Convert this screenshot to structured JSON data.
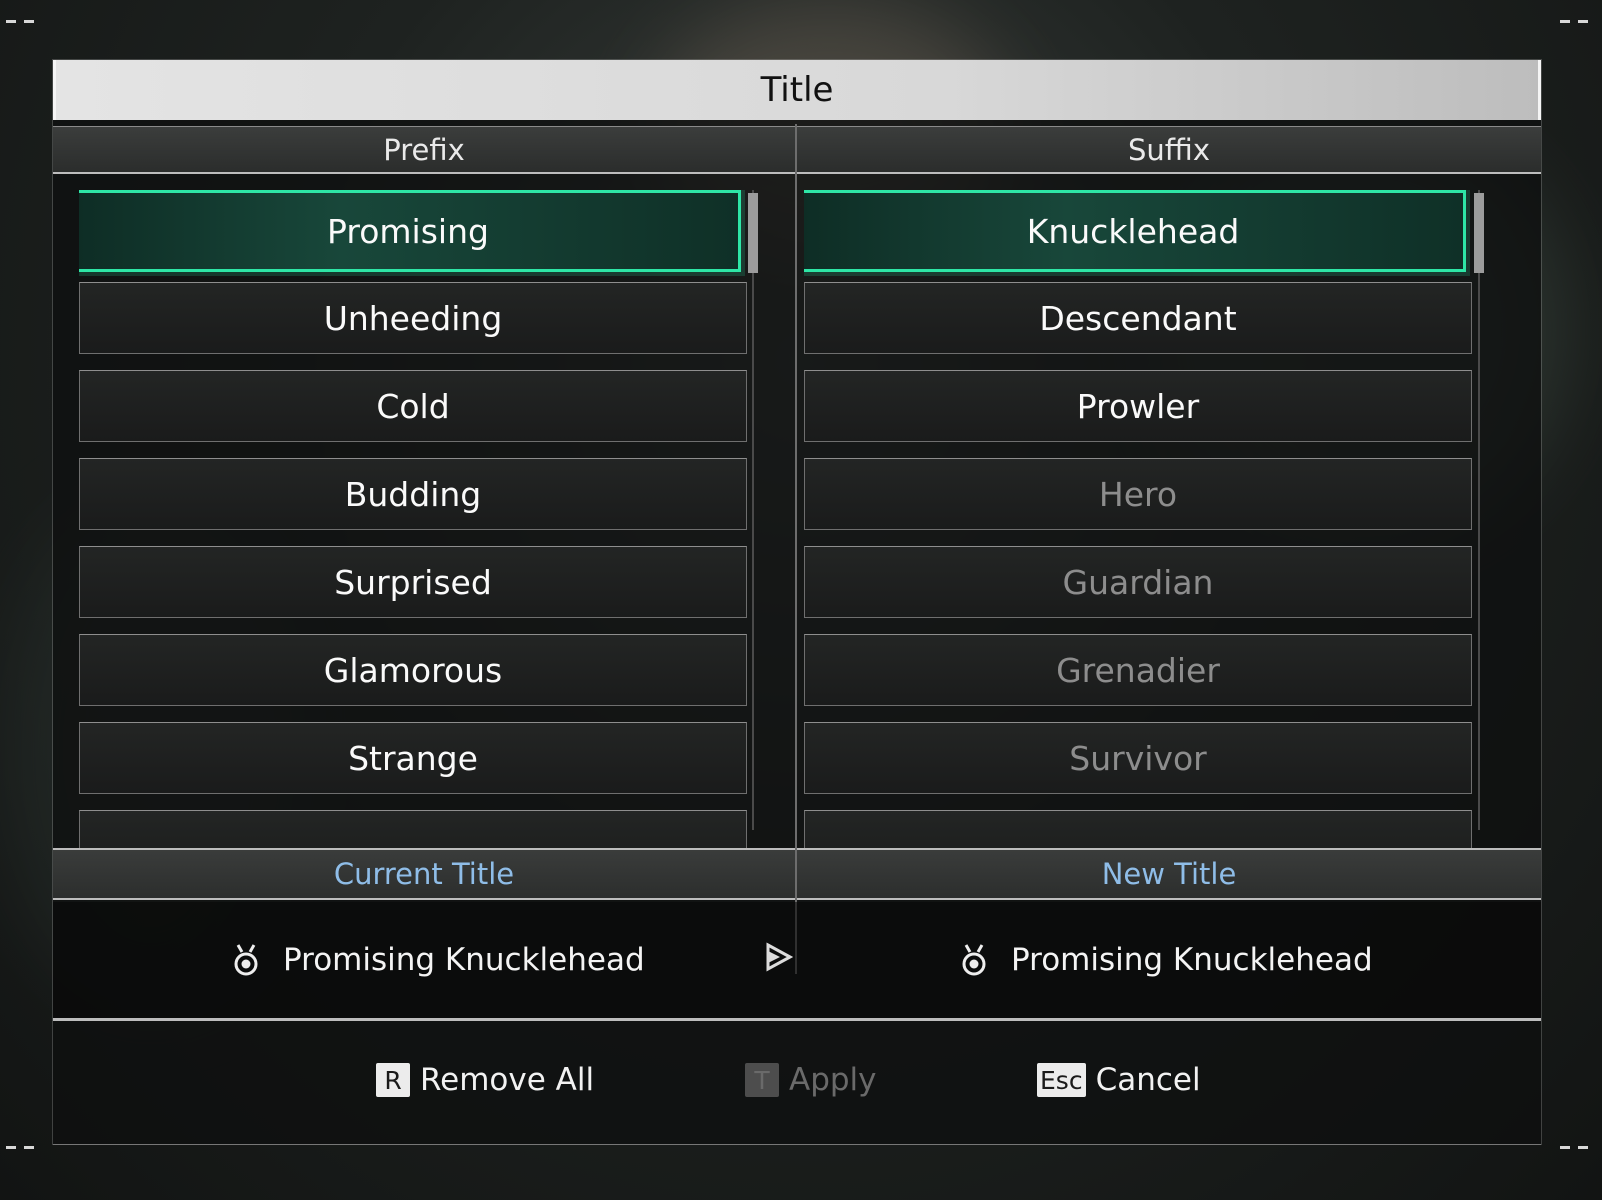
{
  "dialog": {
    "title": "Title"
  },
  "prefix": {
    "header": "Prefix",
    "items": [
      {
        "label": "Promising",
        "selected": true,
        "dim": false
      },
      {
        "label": "Unheeding",
        "selected": false,
        "dim": false
      },
      {
        "label": "Cold",
        "selected": false,
        "dim": false
      },
      {
        "label": "Budding",
        "selected": false,
        "dim": false
      },
      {
        "label": "Surprised",
        "selected": false,
        "dim": false
      },
      {
        "label": "Glamorous",
        "selected": false,
        "dim": false
      },
      {
        "label": "Strange",
        "selected": false,
        "dim": false
      },
      {
        "label": "",
        "selected": false,
        "dim": false
      }
    ]
  },
  "suffix": {
    "header": "Suffix",
    "items": [
      {
        "label": "Knucklehead",
        "selected": true,
        "dim": false
      },
      {
        "label": "Descendant",
        "selected": false,
        "dim": false
      },
      {
        "label": "Prowler",
        "selected": false,
        "dim": false
      },
      {
        "label": "Hero",
        "selected": false,
        "dim": true
      },
      {
        "label": "Guardian",
        "selected": false,
        "dim": true
      },
      {
        "label": "Grenadier",
        "selected": false,
        "dim": true
      },
      {
        "label": "Survivor",
        "selected": false,
        "dim": true
      },
      {
        "label": "",
        "selected": false,
        "dim": false
      }
    ]
  },
  "current_title": {
    "header": "Current Title",
    "value": "Promising Knucklehead",
    "icon": "medal-icon"
  },
  "new_title": {
    "header": "New Title",
    "value": "Promising Knucklehead",
    "icon": "medal-icon"
  },
  "arrow_icon": "play-arrow-icon",
  "actions": [
    {
      "key": "R",
      "label": "Remove All",
      "enabled": true
    },
    {
      "key": "T",
      "label": "Apply",
      "enabled": false
    },
    {
      "key": "Esc",
      "label": "Cancel",
      "enabled": true
    }
  ],
  "colors": {
    "accent": "#2ee6a6",
    "info_header": "#8fbde8"
  }
}
